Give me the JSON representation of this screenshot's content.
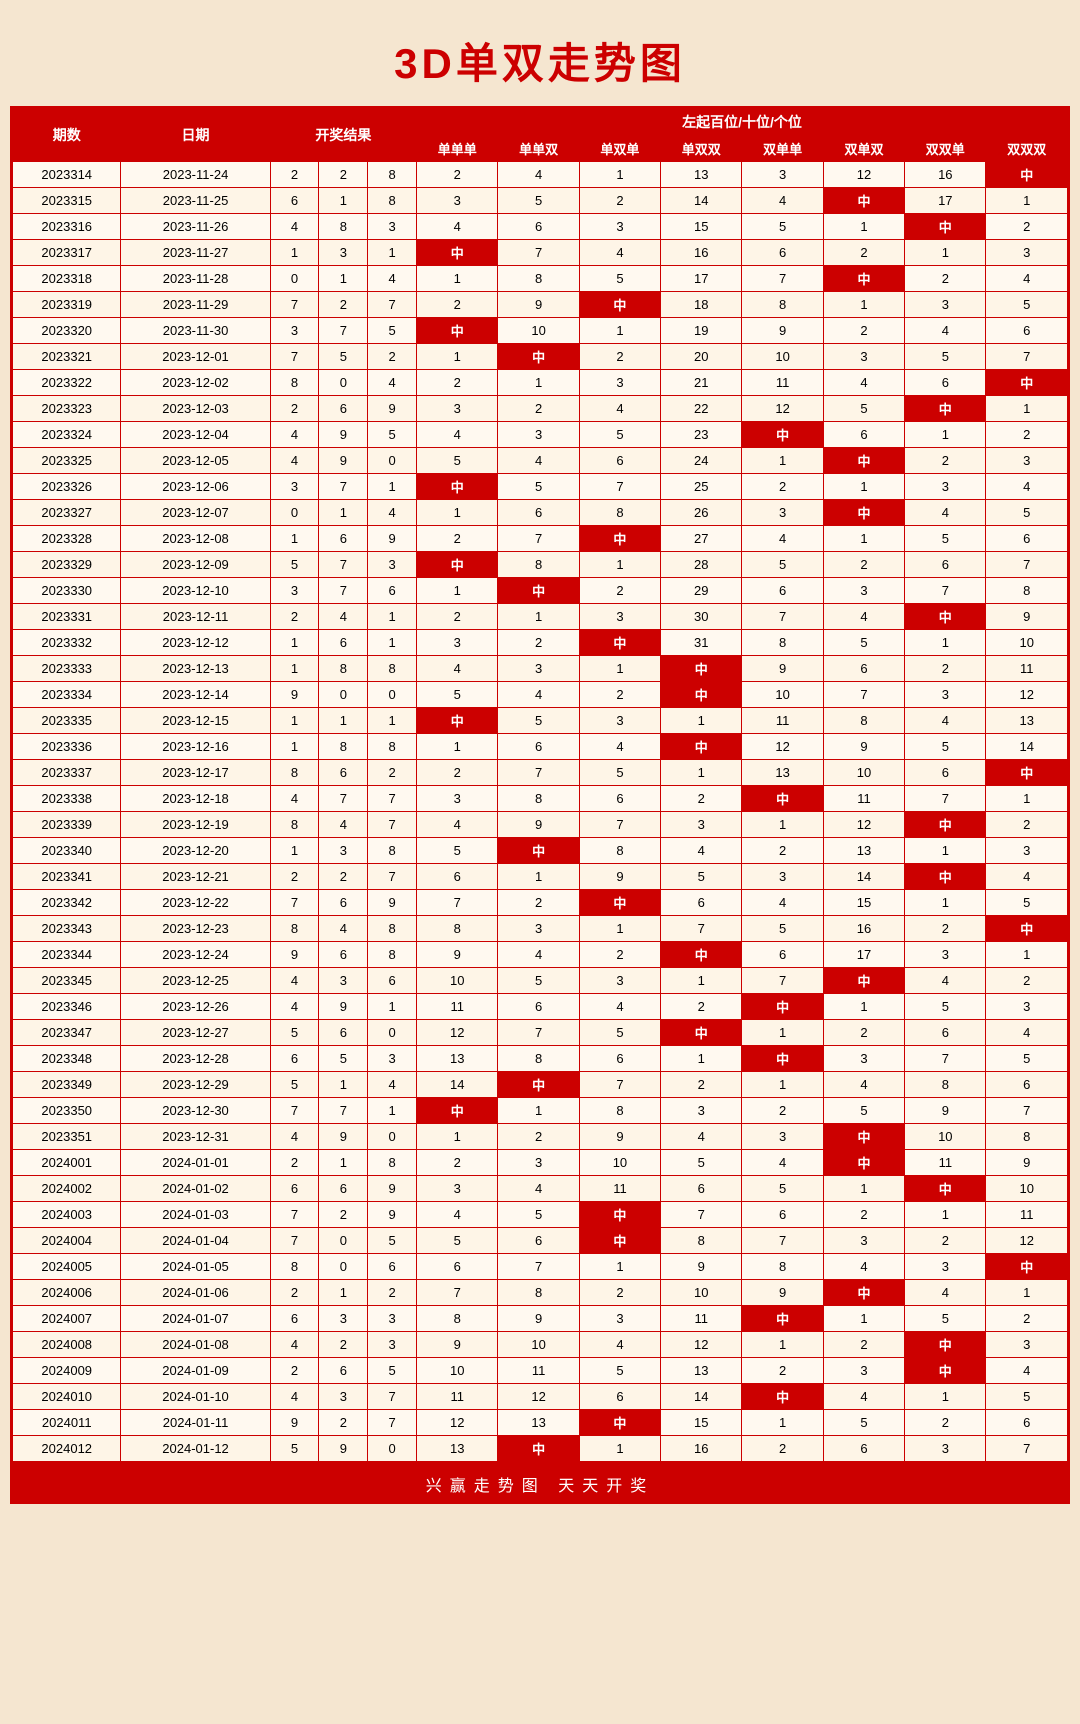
{
  "title": "3D单双走势图",
  "header": {
    "col1": "期数",
    "col2": "日期",
    "col3": "开奖结果",
    "col_span_label": "左起百位/十位/个位",
    "sub_headers": [
      "单单单",
      "单单双",
      "单双单",
      "单双双",
      "双单单",
      "双单双",
      "双双单",
      "双双双"
    ]
  },
  "rows": [
    {
      "qishu": "2023314",
      "date": "2023-11-24",
      "r": [
        2,
        2,
        8
      ],
      "vals": [
        2,
        4,
        1,
        13,
        3,
        12,
        16,
        "中"
      ]
    },
    {
      "qishu": "2023315",
      "date": "2023-11-25",
      "r": [
        6,
        1,
        8
      ],
      "vals": [
        3,
        5,
        2,
        14,
        4,
        "中",
        17,
        1
      ]
    },
    {
      "qishu": "2023316",
      "date": "2023-11-26",
      "r": [
        4,
        8,
        3
      ],
      "vals": [
        4,
        6,
        3,
        15,
        5,
        1,
        "中",
        2
      ]
    },
    {
      "qishu": "2023317",
      "date": "2023-11-27",
      "r": [
        1,
        3,
        1
      ],
      "vals": [
        "中",
        7,
        4,
        16,
        6,
        2,
        1,
        3
      ]
    },
    {
      "qishu": "2023318",
      "date": "2023-11-28",
      "r": [
        0,
        1,
        4
      ],
      "vals": [
        1,
        8,
        5,
        17,
        7,
        "中",
        2,
        4
      ]
    },
    {
      "qishu": "2023319",
      "date": "2023-11-29",
      "r": [
        7,
        2,
        7
      ],
      "vals": [
        2,
        9,
        "中",
        18,
        8,
        1,
        3,
        5
      ]
    },
    {
      "qishu": "2023320",
      "date": "2023-11-30",
      "r": [
        3,
        7,
        5
      ],
      "vals": [
        "中",
        10,
        1,
        19,
        9,
        2,
        4,
        6
      ]
    },
    {
      "qishu": "2023321",
      "date": "2023-12-01",
      "r": [
        7,
        5,
        2
      ],
      "vals": [
        1,
        "中",
        2,
        20,
        10,
        3,
        5,
        7
      ]
    },
    {
      "qishu": "2023322",
      "date": "2023-12-02",
      "r": [
        8,
        0,
        4
      ],
      "vals": [
        2,
        1,
        3,
        21,
        11,
        4,
        6,
        "中"
      ]
    },
    {
      "qishu": "2023323",
      "date": "2023-12-03",
      "r": [
        2,
        6,
        9
      ],
      "vals": [
        3,
        2,
        4,
        22,
        12,
        5,
        "中",
        1
      ]
    },
    {
      "qishu": "2023324",
      "date": "2023-12-04",
      "r": [
        4,
        9,
        5
      ],
      "vals": [
        4,
        3,
        5,
        23,
        "中",
        6,
        1,
        2
      ]
    },
    {
      "qishu": "2023325",
      "date": "2023-12-05",
      "r": [
        4,
        9,
        0
      ],
      "vals": [
        5,
        4,
        6,
        24,
        1,
        "中",
        2,
        3
      ]
    },
    {
      "qishu": "2023326",
      "date": "2023-12-06",
      "r": [
        3,
        7,
        1
      ],
      "vals": [
        "中",
        5,
        7,
        25,
        2,
        1,
        3,
        4
      ]
    },
    {
      "qishu": "2023327",
      "date": "2023-12-07",
      "r": [
        0,
        1,
        4
      ],
      "vals": [
        1,
        6,
        8,
        26,
        3,
        "中",
        4,
        5
      ]
    },
    {
      "qishu": "2023328",
      "date": "2023-12-08",
      "r": [
        1,
        6,
        9
      ],
      "vals": [
        2,
        7,
        "中",
        27,
        4,
        1,
        5,
        6
      ]
    },
    {
      "qishu": "2023329",
      "date": "2023-12-09",
      "r": [
        5,
        7,
        3
      ],
      "vals": [
        "中",
        8,
        1,
        28,
        5,
        2,
        6,
        7
      ]
    },
    {
      "qishu": "2023330",
      "date": "2023-12-10",
      "r": [
        3,
        7,
        6
      ],
      "vals": [
        1,
        "中",
        2,
        29,
        6,
        3,
        7,
        8
      ]
    },
    {
      "qishu": "2023331",
      "date": "2023-12-11",
      "r": [
        2,
        4,
        1
      ],
      "vals": [
        2,
        1,
        3,
        30,
        7,
        4,
        "中",
        9
      ]
    },
    {
      "qishu": "2023332",
      "date": "2023-12-12",
      "r": [
        1,
        6,
        1
      ],
      "vals": [
        3,
        2,
        "中",
        31,
        8,
        5,
        1,
        10
      ]
    },
    {
      "qishu": "2023333",
      "date": "2023-12-13",
      "r": [
        1,
        8,
        8
      ],
      "vals": [
        4,
        3,
        1,
        "中",
        9,
        6,
        2,
        11
      ]
    },
    {
      "qishu": "2023334",
      "date": "2023-12-14",
      "r": [
        9,
        0,
        0
      ],
      "vals": [
        5,
        4,
        2,
        "中",
        10,
        7,
        3,
        12
      ]
    },
    {
      "qishu": "2023335",
      "date": "2023-12-15",
      "r": [
        1,
        1,
        1
      ],
      "vals": [
        "中",
        5,
        3,
        1,
        11,
        8,
        4,
        13
      ]
    },
    {
      "qishu": "2023336",
      "date": "2023-12-16",
      "r": [
        1,
        8,
        8
      ],
      "vals": [
        1,
        6,
        4,
        "中",
        12,
        9,
        5,
        14
      ]
    },
    {
      "qishu": "2023337",
      "date": "2023-12-17",
      "r": [
        8,
        6,
        2
      ],
      "vals": [
        2,
        7,
        5,
        1,
        13,
        10,
        6,
        "中"
      ]
    },
    {
      "qishu": "2023338",
      "date": "2023-12-18",
      "r": [
        4,
        7,
        7
      ],
      "vals": [
        3,
        8,
        6,
        2,
        "中",
        11,
        7,
        1
      ]
    },
    {
      "qishu": "2023339",
      "date": "2023-12-19",
      "r": [
        8,
        4,
        7
      ],
      "vals": [
        4,
        9,
        7,
        3,
        1,
        12,
        "中",
        2
      ]
    },
    {
      "qishu": "2023340",
      "date": "2023-12-20",
      "r": [
        1,
        3,
        8
      ],
      "vals": [
        5,
        "中",
        8,
        4,
        2,
        13,
        1,
        3
      ]
    },
    {
      "qishu": "2023341",
      "date": "2023-12-21",
      "r": [
        2,
        2,
        7
      ],
      "vals": [
        6,
        1,
        9,
        5,
        3,
        14,
        "中",
        4
      ]
    },
    {
      "qishu": "2023342",
      "date": "2023-12-22",
      "r": [
        7,
        6,
        9
      ],
      "vals": [
        7,
        2,
        "中",
        6,
        4,
        15,
        1,
        5
      ]
    },
    {
      "qishu": "2023343",
      "date": "2023-12-23",
      "r": [
        8,
        4,
        8
      ],
      "vals": [
        8,
        3,
        1,
        7,
        5,
        16,
        2,
        "中"
      ]
    },
    {
      "qishu": "2023344",
      "date": "2023-12-24",
      "r": [
        9,
        6,
        8
      ],
      "vals": [
        9,
        4,
        2,
        "中",
        6,
        17,
        3,
        1
      ]
    },
    {
      "qishu": "2023345",
      "date": "2023-12-25",
      "r": [
        4,
        3,
        6
      ],
      "vals": [
        10,
        5,
        3,
        1,
        7,
        "中",
        4,
        2
      ]
    },
    {
      "qishu": "2023346",
      "date": "2023-12-26",
      "r": [
        4,
        9,
        1
      ],
      "vals": [
        11,
        6,
        4,
        2,
        "中",
        1,
        5,
        3
      ]
    },
    {
      "qishu": "2023347",
      "date": "2023-12-27",
      "r": [
        5,
        6,
        0
      ],
      "vals": [
        12,
        7,
        5,
        "中",
        1,
        2,
        6,
        4
      ]
    },
    {
      "qishu": "2023348",
      "date": "2023-12-28",
      "r": [
        6,
        5,
        3
      ],
      "vals": [
        13,
        8,
        6,
        1,
        "中",
        3,
        7,
        5
      ]
    },
    {
      "qishu": "2023349",
      "date": "2023-12-29",
      "r": [
        5,
        1,
        4
      ],
      "vals": [
        14,
        "中",
        7,
        2,
        1,
        4,
        8,
        6
      ]
    },
    {
      "qishu": "2023350",
      "date": "2023-12-30",
      "r": [
        7,
        7,
        1
      ],
      "vals": [
        "中",
        1,
        8,
        3,
        2,
        5,
        9,
        7
      ]
    },
    {
      "qishu": "2023351",
      "date": "2023-12-31",
      "r": [
        4,
        9,
        0
      ],
      "vals": [
        1,
        2,
        9,
        4,
        3,
        "中",
        10,
        8
      ]
    },
    {
      "qishu": "2024001",
      "date": "2024-01-01",
      "r": [
        2,
        1,
        8
      ],
      "vals": [
        2,
        3,
        10,
        5,
        4,
        "中",
        11,
        9
      ]
    },
    {
      "qishu": "2024002",
      "date": "2024-01-02",
      "r": [
        6,
        6,
        9
      ],
      "vals": [
        3,
        4,
        11,
        6,
        5,
        1,
        "中",
        10
      ]
    },
    {
      "qishu": "2024003",
      "date": "2024-01-03",
      "r": [
        7,
        2,
        9
      ],
      "vals": [
        4,
        5,
        "中",
        7,
        6,
        2,
        1,
        11
      ]
    },
    {
      "qishu": "2024004",
      "date": "2024-01-04",
      "r": [
        7,
        0,
        5
      ],
      "vals": [
        5,
        6,
        "中",
        8,
        7,
        3,
        2,
        12
      ]
    },
    {
      "qishu": "2024005",
      "date": "2024-01-05",
      "r": [
        8,
        0,
        6
      ],
      "vals": [
        6,
        7,
        1,
        9,
        8,
        4,
        3,
        "中"
      ]
    },
    {
      "qishu": "2024006",
      "date": "2024-01-06",
      "r": [
        2,
        1,
        2
      ],
      "vals": [
        7,
        8,
        2,
        10,
        9,
        "中",
        4,
        1
      ]
    },
    {
      "qishu": "2024007",
      "date": "2024-01-07",
      "r": [
        6,
        3,
        3
      ],
      "vals": [
        8,
        9,
        3,
        11,
        "中",
        1,
        5,
        2
      ]
    },
    {
      "qishu": "2024008",
      "date": "2024-01-08",
      "r": [
        4,
        2,
        3
      ],
      "vals": [
        9,
        10,
        4,
        12,
        1,
        2,
        "中",
        3
      ]
    },
    {
      "qishu": "2024009",
      "date": "2024-01-09",
      "r": [
        2,
        6,
        5
      ],
      "vals": [
        10,
        11,
        5,
        13,
        2,
        3,
        "中",
        4
      ]
    },
    {
      "qishu": "2024010",
      "date": "2024-01-10",
      "r": [
        4,
        3,
        7
      ],
      "vals": [
        11,
        12,
        6,
        14,
        "中",
        4,
        1,
        5
      ]
    },
    {
      "qishu": "2024011",
      "date": "2024-01-11",
      "r": [
        9,
        2,
        7
      ],
      "vals": [
        12,
        13,
        "中",
        15,
        1,
        5,
        2,
        6
      ]
    },
    {
      "qishu": "2024012",
      "date": "2024-01-12",
      "r": [
        5,
        9,
        0
      ],
      "vals": [
        13,
        "中",
        1,
        16,
        2,
        6,
        3,
        7
      ]
    }
  ],
  "footer": "兴赢走势图    天天开奖"
}
